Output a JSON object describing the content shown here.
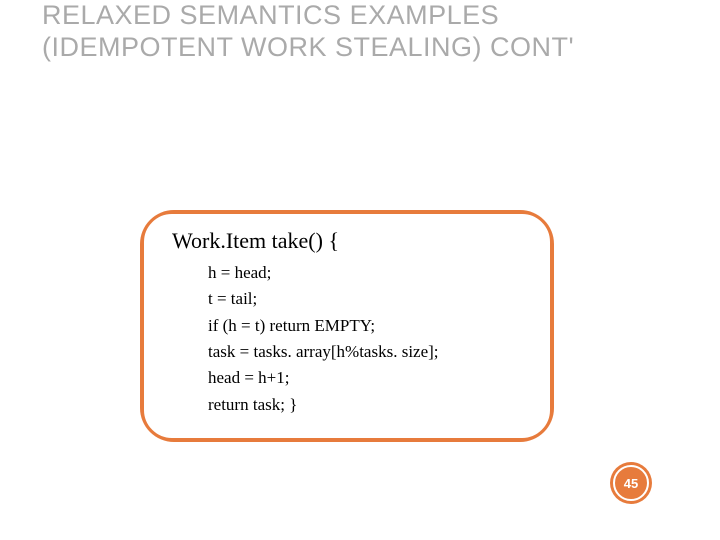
{
  "title": "RELAXED SEMANTICS EXAMPLES (IDEMPOTENT WORK STEALING) CONT'",
  "code": {
    "signature": "Work.Item take() {",
    "lines": [
      "h = head;",
      "t = tail;",
      "if (h = t) return EMPTY;",
      "task = tasks. array[h%tasks. size];",
      "head = h+1;",
      "return task; }"
    ]
  },
  "page_number": "45"
}
